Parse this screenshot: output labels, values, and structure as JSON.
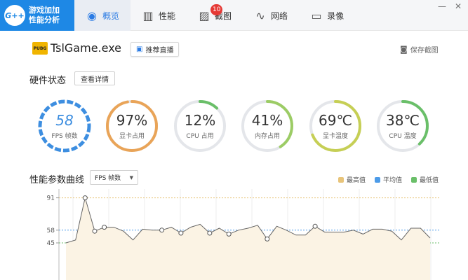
{
  "app": {
    "logo_badge": "G++",
    "logo_line1": "游戏加加",
    "logo_line2": "性能分析"
  },
  "nav": {
    "items": [
      {
        "label": "概览",
        "icon": "eye-icon",
        "active": true
      },
      {
        "label": "性能",
        "icon": "bar-chart-icon",
        "active": false
      },
      {
        "label": "截图",
        "icon": "image-icon",
        "active": false,
        "badge": "10"
      },
      {
        "label": "网络",
        "icon": "pulse-icon",
        "active": false
      },
      {
        "label": "录像",
        "icon": "video-icon",
        "active": false
      }
    ],
    "minimize": "—",
    "close": "✕"
  },
  "game": {
    "logo_text": "PUBG",
    "title": "TslGame.exe",
    "live_label": "推荐直播",
    "save_label": "保存截图"
  },
  "hardware": {
    "title": "硬件状态",
    "detail_label": "查看详情",
    "gauges": [
      {
        "value": "58",
        "label": "FPS 帧数",
        "fraction": 1.0,
        "color": "#3d8ee0"
      },
      {
        "value": "97%",
        "label": "显卡占用",
        "fraction": 0.97,
        "color": "#e9a458"
      },
      {
        "value": "12%",
        "label": "CPU 占用",
        "fraction": 0.12,
        "color": "#6abf69"
      },
      {
        "value": "41%",
        "label": "内存占用",
        "fraction": 0.41,
        "color": "#9ccc65"
      },
      {
        "value": "69℃",
        "label": "显卡温度",
        "fraction": 0.69,
        "color": "#c6cf55"
      },
      {
        "value": "38℃",
        "label": "CPU 温度",
        "fraction": 0.38,
        "color": "#6abf69"
      }
    ]
  },
  "curve": {
    "title": "性能参数曲线",
    "select_value": "FPS 帧数",
    "legend": [
      {
        "label": "最高值",
        "color": "#e8c47a"
      },
      {
        "label": "平均值",
        "color": "#4c9be8"
      },
      {
        "label": "最低值",
        "color": "#6abf69"
      }
    ]
  },
  "chart_data": {
    "type": "line",
    "title": "",
    "xlabel": "",
    "ylabel": "",
    "yticks": [
      91,
      58,
      45
    ],
    "ylim": [
      30,
      100
    ],
    "max_line": 91,
    "avg_line": 58,
    "min_line": 45,
    "series": [
      {
        "values": [
          45,
          48,
          91,
          57,
          61,
          61,
          57,
          48,
          59,
          58,
          58,
          61,
          55,
          61,
          64,
          55,
          60,
          54,
          58,
          60,
          63,
          49,
          62,
          58,
          53,
          53,
          62,
          56,
          56,
          56,
          58,
          54,
          59,
          59,
          57,
          48,
          60,
          60,
          50
        ],
        "markers": [
          2,
          3,
          4,
          10,
          12,
          15,
          17,
          21,
          26
        ]
      }
    ]
  }
}
